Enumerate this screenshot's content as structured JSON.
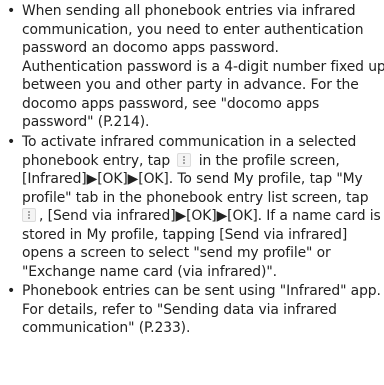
{
  "bullet_glyph": "•",
  "icon": "more-vert-icon",
  "items": [
    {
      "lines": [
        "When sending all phonebook entries via infrared",
        "communication, you need to enter authentication",
        "password an docomo apps password.",
        "Authentication password is a 4-digit number fixed up",
        "between you and other party in advance. For the",
        "docomo apps password, see \"docomo apps",
        "password\" (P.214)."
      ]
    },
    {
      "line1a": "To activate infrared communication in a selected",
      "line2a": "phonebook entry, tap ",
      "line2b": " in the profile screen,",
      "line3": "[Infrared]▶[OK]▶[OK]. To send My profile, tap \"My",
      "line4": "profile\" tab in the phonebook entry list screen, tap",
      "line5b": ", [Send via infrared]▶[OK]▶[OK]. If a name card is",
      "line6": "stored in My profile, tapping [Send via infrared]",
      "line7": "opens a screen to select \"send my profile\" or",
      "line8": "\"Exchange name card (via infrared)\"."
    },
    {
      "lines": [
        "Phonebook entries can be sent using \"Infrared\" app.",
        "For details, refer to \"Sending data via infrared",
        "communication\" (P.233)."
      ]
    }
  ]
}
